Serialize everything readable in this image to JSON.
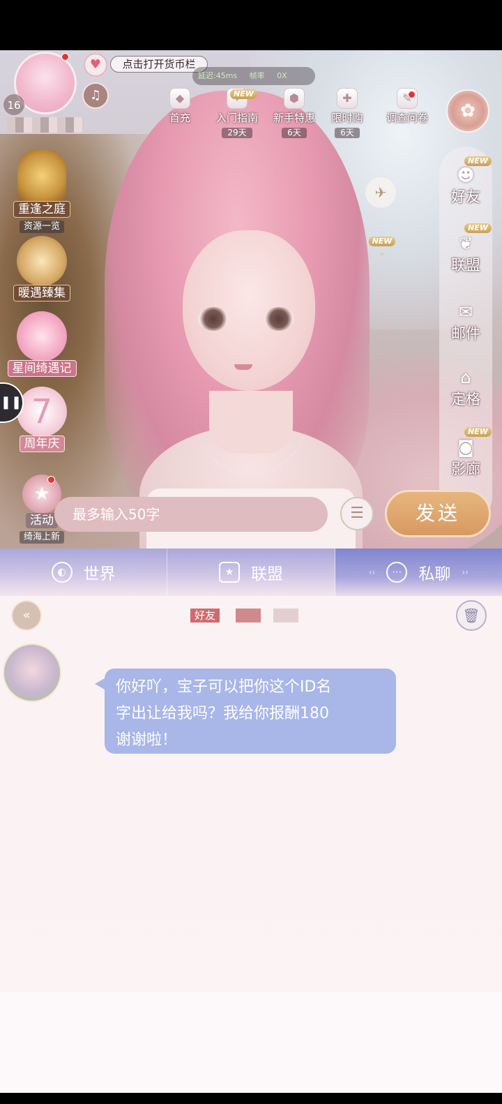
{
  "hud": {
    "level": "16",
    "currency_tip": "点击打开货币栏",
    "latency": "延迟:45ms",
    "fps_label": "帧率",
    "fps_value": "0X"
  },
  "top_icons": [
    {
      "label": "首充",
      "icon": "gift-box-icon"
    },
    {
      "label": "入门指南",
      "days": "29天",
      "new": "NEW"
    },
    {
      "label": "新手特惠",
      "days": "6天"
    },
    {
      "label": "限时购",
      "days": "6天"
    },
    {
      "label": "调查问卷"
    }
  ],
  "left_activities": [
    {
      "label": "重逢之庭",
      "sub": "资源一览"
    },
    {
      "label": "暖遇臻集"
    },
    {
      "label": "星间绮遇记"
    },
    {
      "label": "周年庆"
    },
    {
      "label": "活动",
      "sub": "绮海上新"
    }
  ],
  "right_menu": [
    {
      "label": "好友",
      "new": "NEW"
    },
    {
      "label": "联盟",
      "new": "NEW"
    },
    {
      "label": "邮件"
    },
    {
      "label": "定格"
    },
    {
      "label": "影廊",
      "new": "NEW"
    }
  ],
  "scene_new": "NEW",
  "chat": {
    "tabs": [
      {
        "label": "世界"
      },
      {
        "label": "联盟"
      },
      {
        "label": "私聊"
      }
    ],
    "friend_tag": "好友",
    "message": "你好吖，宝子可以把你这个ID名\n字出让给我吗？我给你报酬180\n谢谢啦！",
    "input_placeholder": "最多输入50字",
    "send_label": "发送"
  }
}
